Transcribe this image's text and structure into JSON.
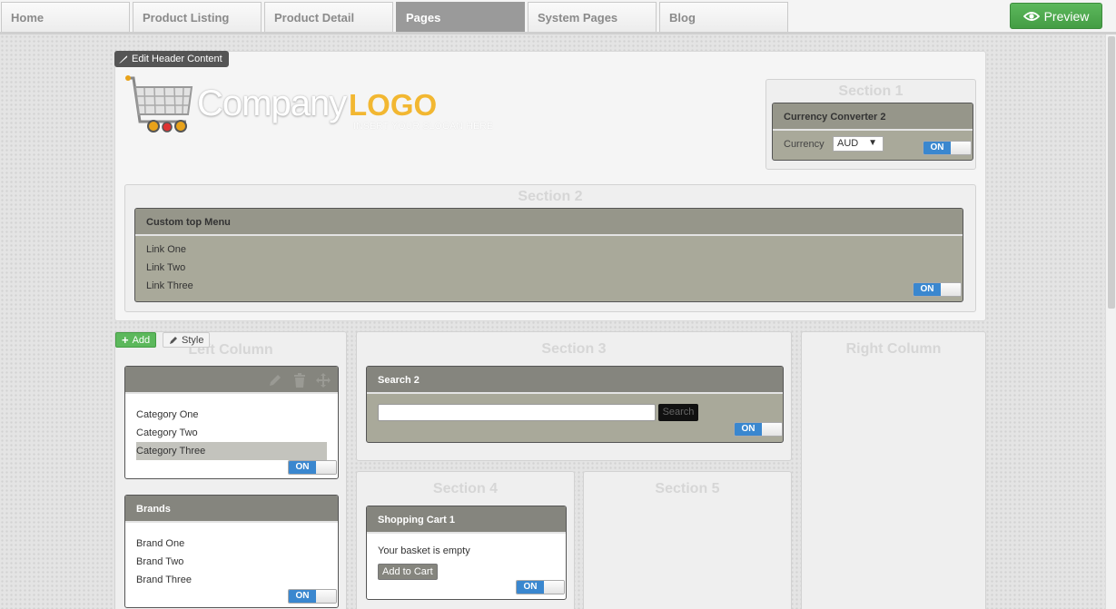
{
  "tabs": [
    {
      "label": "Home"
    },
    {
      "label": "Product Listing"
    },
    {
      "label": "Product Detail"
    },
    {
      "label": "Pages",
      "active": true
    },
    {
      "label": "System Pages"
    },
    {
      "label": "Blog"
    }
  ],
  "preview": {
    "label": "Preview"
  },
  "header": {
    "edit_label": "Edit Header Content",
    "logo_company": "Company",
    "logo_logo": "LOGO",
    "logo_slogan": "INSERT YOUR SLOGAN HERE"
  },
  "section1": {
    "title": "Section 1",
    "widget_title": "Currency Converter 2",
    "currency_label": "Currency",
    "currency_value": "AUD",
    "toggle": "ON"
  },
  "section2": {
    "title": "Section 2",
    "widget_title": "Custom top Menu",
    "links": [
      "Link One",
      "Link Two",
      "Link Three"
    ],
    "toggle": "ON"
  },
  "left_column": {
    "title": "Left Column",
    "add_label": "Add",
    "style_label": "Style",
    "categories": [
      "Category One",
      "Category Two",
      "Category Three"
    ],
    "categories_toggle": "ON",
    "brands_title": "Brands",
    "brands": [
      "Brand One",
      "Brand Two",
      "Brand Three"
    ],
    "brands_toggle": "ON"
  },
  "section3": {
    "title": "Section 3",
    "widget_title": "Search 2",
    "search_button": "Search",
    "search_value": "",
    "toggle": "ON"
  },
  "section4": {
    "title": "Section 4",
    "widget_title": "Shopping Cart 1",
    "basket_text": "Your basket is empty",
    "add_to_cart": "Add to Cart",
    "toggle": "ON"
  },
  "section5": {
    "title": "Section 5"
  },
  "right_column": {
    "title": "Right Column"
  },
  "colors": {
    "active_tab": "#9a9a9a",
    "preview_green": "#5cb85c",
    "toggle_blue": "#3a87cf",
    "widget_head": "#85857e",
    "logo_yellow": "#f2b731"
  }
}
